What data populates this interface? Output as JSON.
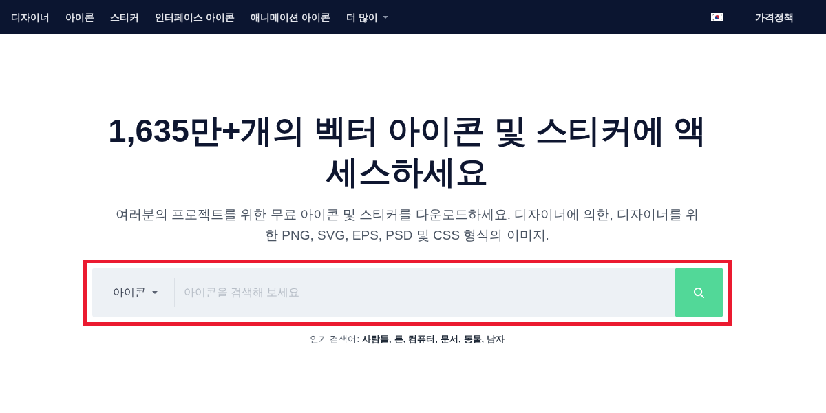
{
  "nav": {
    "items": [
      {
        "label": "디자이너",
        "kind": "link"
      },
      {
        "label": "아이콘",
        "kind": "link"
      },
      {
        "label": "스티커",
        "kind": "link"
      },
      {
        "label": "인터페이스 아이콘",
        "kind": "link"
      },
      {
        "label": "애니메이션 아이콘",
        "kind": "link"
      },
      {
        "label": "더 많이",
        "kind": "dropdown"
      }
    ],
    "pricing": "가격정책"
  },
  "hero": {
    "title": "1,635만+개의 벡터 아이콘 및 스티커에 액세스하세요",
    "subtitle": "여러분의 프로젝트를 위한 무료 아이콘 및 스티커를 다운로드하세요. 디자이너에 의한, 디자이너를 위한 PNG, SVG, EPS, PSD 및 CSS 형식의 이미지."
  },
  "search": {
    "highlighted": true,
    "type_selector": "아이콘",
    "placeholder": "아이콘을 검색해 보세요"
  },
  "popular": {
    "label": "인기 검색어:",
    "terms": [
      "사람들,",
      "돈,",
      "컴퓨터,",
      "문서,",
      "동물,",
      "남자"
    ]
  }
}
